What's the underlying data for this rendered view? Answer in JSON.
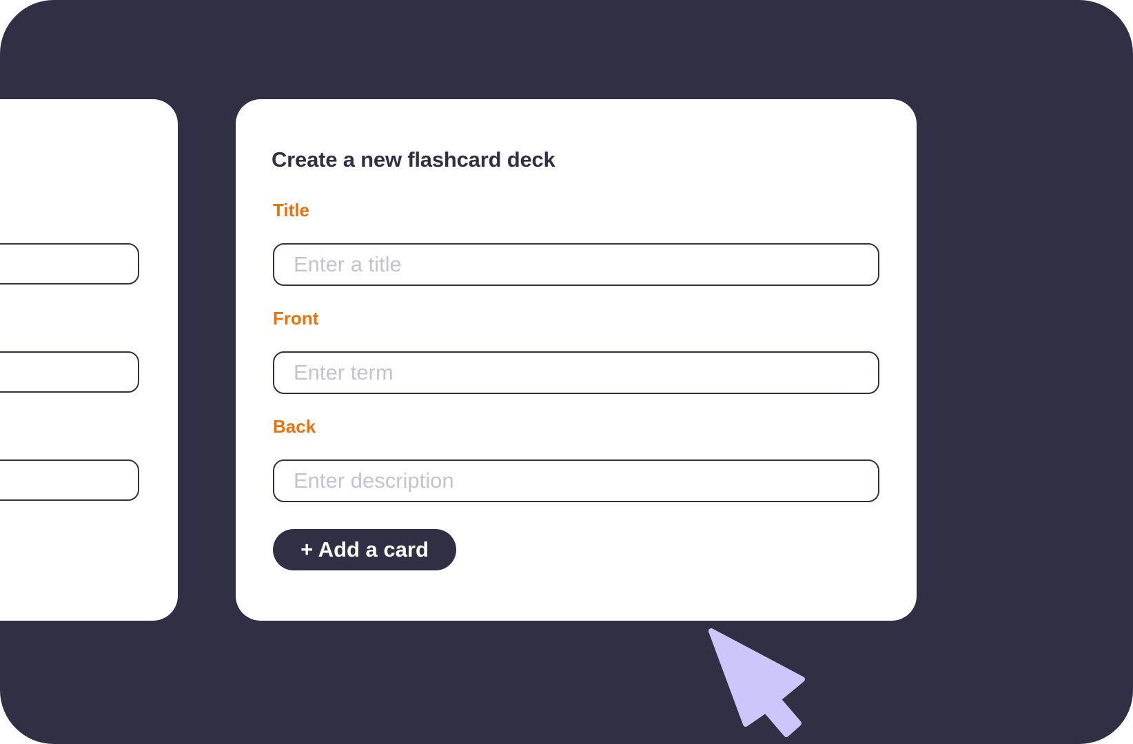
{
  "form": {
    "heading": "Create a new flashcard deck",
    "fields": [
      {
        "label": "Title",
        "placeholder": "Enter a title",
        "value": ""
      },
      {
        "label": "Front",
        "placeholder": "Enter term",
        "value": ""
      },
      {
        "label": "Back",
        "placeholder": "Enter description",
        "value": ""
      }
    ],
    "add_button_label": "+ Add a card"
  },
  "icons": {
    "cursor": "mouse-pointer-icon"
  },
  "colors": {
    "background": "#312f44",
    "card": "#ffffff",
    "label_accent": "#e8720c",
    "placeholder": "#c5c3d0",
    "cursor": "#cdc6fa"
  }
}
